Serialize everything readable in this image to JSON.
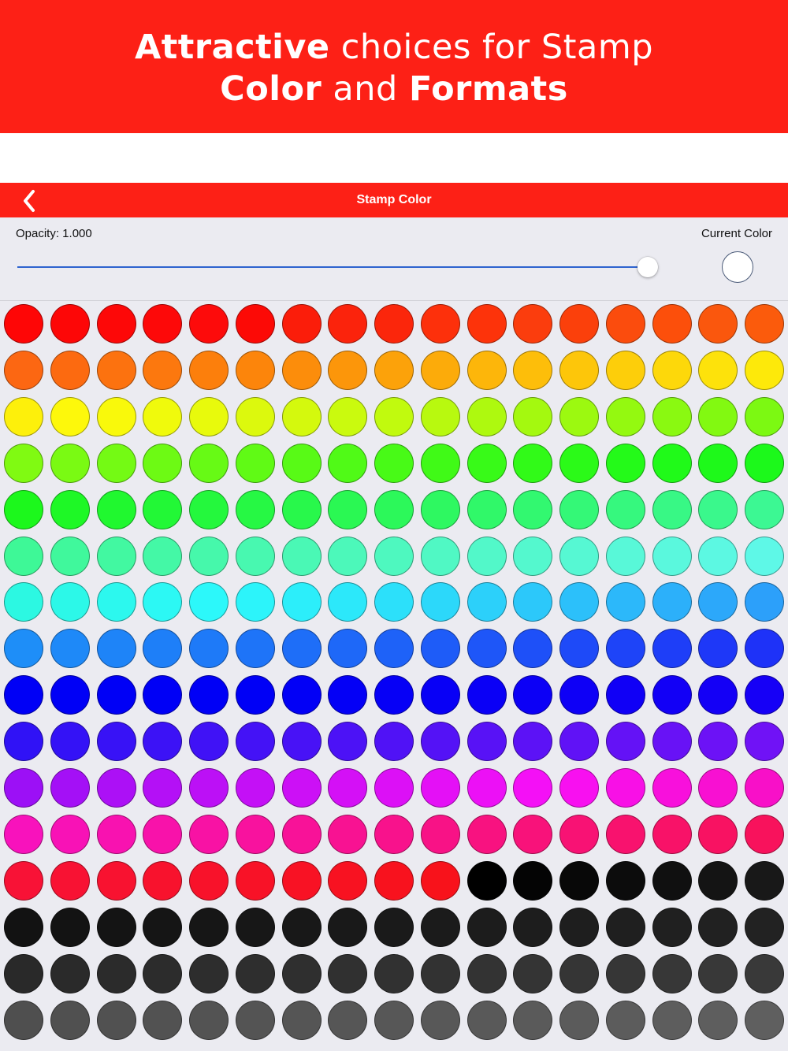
{
  "promo": {
    "line1_bold": "Attractive",
    "line1_rest": " choices for Stamp",
    "line2_bold1": "Color",
    "line2_mid": " and ",
    "line2_bold2": "Formats",
    "background": "#fd2016"
  },
  "navbar": {
    "title": "Stamp Color",
    "back_icon": "chevron-left-icon",
    "background": "#fd2016"
  },
  "controls": {
    "opacity_label": "Opacity: 1.000",
    "opacity_value": 1.0,
    "current_color_label": "Current Color",
    "current_color": "#ffffff",
    "slider_color": "#2e63cf"
  },
  "palette": {
    "rows": 16,
    "columns": 17,
    "colors": [
      "#fe0606",
      "#fd0707",
      "#fd0808",
      "#fd0909",
      "#fd0b0b",
      "#fc0a06",
      "#fb1d0a",
      "#fb230c",
      "#fb260b",
      "#fd300b",
      "#fd330a",
      "#fb3d0d",
      "#fb400b",
      "#fb4c0d",
      "#fc4f0b",
      "#fa570d",
      "#fb5b0c",
      "#fc6712",
      "#fc6a10",
      "#fc720f",
      "#fc780e",
      "#fc7f0c",
      "#fc850b",
      "#fc8d0b",
      "#fc960a",
      "#fca20a",
      "#fcab0a",
      "#fdb60a",
      "#fdbe0a",
      "#fdc60a",
      "#fdce0a",
      "#fdd80a",
      "#fde20b",
      "#fde90a",
      "#fdf00b",
      "#fdf80b",
      "#f9f90b",
      "#f0fa0c",
      "#e8fa0c",
      "#dcf90d",
      "#d4f90d",
      "#cafa0e",
      "#c1fa0e",
      "#b8f90f",
      "#aef90f",
      "#a4f90f",
      "#9cf910",
      "#94f910",
      "#8af911",
      "#82f911",
      "#7cf912",
      "#80fa12",
      "#7afa13",
      "#74fa14",
      "#6dfa14",
      "#67fa15",
      "#60fa15",
      "#58fa16",
      "#50fa17",
      "#48fa17",
      "#40fa17",
      "#38fa18",
      "#31fa18",
      "#2bfa18",
      "#24fa19",
      "#20fa19",
      "#1ef91a",
      "#1cf91b",
      "#1cf81c",
      "#1ef826",
      "#20f82f",
      "#22f836",
      "#24f83d",
      "#26f844",
      "#28f84b",
      "#2af853",
      "#2cf85a",
      "#2ef861",
      "#30f869",
      "#32f870",
      "#34f877",
      "#36f87e",
      "#38f885",
      "#3af88c",
      "#3cf893",
      "#3ef897",
      "#40f89c",
      "#42f8a1",
      "#44f8a6",
      "#46f8ab",
      "#48f8b0",
      "#4af8b5",
      "#4cf8ba",
      "#4ef8bf",
      "#50f8c4",
      "#52f8c9",
      "#54f8ce",
      "#56f8d3",
      "#58f8d8",
      "#5af8dd",
      "#5cf8e2",
      "#5ef8e7",
      "#2cf8e2",
      "#2cf8e8",
      "#2cf8ee",
      "#2cf8f4",
      "#2cf8fa",
      "#2cf4fa",
      "#2ceefa",
      "#2ce8fa",
      "#2ce0fa",
      "#2cd8fa",
      "#2cd0fa",
      "#2cc8fa",
      "#2cc0fa",
      "#2cb8fa",
      "#2cb0fa",
      "#2ca8fa",
      "#2ca0fa",
      "#1e8ef8",
      "#1e89f8",
      "#1e84f8",
      "#1e7ff8",
      "#1e7af8",
      "#1e74f8",
      "#1e6ef8",
      "#1e68f8",
      "#1e62f8",
      "#1e5cf8",
      "#1e56f8",
      "#1e50f8",
      "#1e4af8",
      "#1e44f8",
      "#1e3ef8",
      "#1e38f8",
      "#1e32f8",
      "#0000f6",
      "#0000f6",
      "#0000f6",
      "#0000f6",
      "#0000f6",
      "#0000f6",
      "#0200f6",
      "#0400f6",
      "#0600f6",
      "#0800f6",
      "#0a00f6",
      "#0c00f6",
      "#0e00f6",
      "#1000f6",
      "#1200f6",
      "#1400f6",
      "#1600f6",
      "#3012f6",
      "#3412f6",
      "#3812f6",
      "#3c12f6",
      "#4012f6",
      "#4412f6",
      "#4812f6",
      "#4c12f6",
      "#5012f6",
      "#5412f6",
      "#5812f6",
      "#5c12f6",
      "#6012f6",
      "#6412f6",
      "#6812f6",
      "#6c12f6",
      "#7012f6",
      "#9c10f6",
      "#a410f6",
      "#ac10f6",
      "#b410f6",
      "#bc10f6",
      "#c410f6",
      "#cc10f6",
      "#d410f6",
      "#dc10f6",
      "#e410f6",
      "#ec10f6",
      "#f410f6",
      "#f810f0",
      "#f810e6",
      "#f810dc",
      "#f810d2",
      "#f810c8",
      "#f812bc",
      "#f812b6",
      "#f812b0",
      "#f812aa",
      "#f812a4",
      "#f8129e",
      "#f81298",
      "#f81292",
      "#f8128c",
      "#f81286",
      "#f81280",
      "#f8127a",
      "#f81274",
      "#f8126e",
      "#f81268",
      "#f81262",
      "#f8125c",
      "#f81236",
      "#f81233",
      "#f81230",
      "#f8122d",
      "#f8122a",
      "#f81227",
      "#f81224",
      "#f81221",
      "#f8121e",
      "#f8121b",
      "#000000",
      "#040404",
      "#080808",
      "#0c0c0c",
      "#101010",
      "#141414",
      "#181818",
      "#121212",
      "#131313",
      "#141414",
      "#151515",
      "#161616",
      "#171717",
      "#181818",
      "#191919",
      "#1a1a1a",
      "#1b1b1b",
      "#1c1c1c",
      "#1d1d1d",
      "#1e1e1e",
      "#1f1f1f",
      "#202020",
      "#212121",
      "#222222",
      "#292929",
      "#2a2a2a",
      "#2b2b2b",
      "#2c2c2c",
      "#2d2d2d",
      "#2e2e2e",
      "#2f2f2f",
      "#303030",
      "#313131",
      "#323232",
      "#333333",
      "#343434",
      "#353535",
      "#363636",
      "#373737",
      "#383838",
      "#393939",
      "#4f4f4f",
      "#505050",
      "#515151",
      "#525252",
      "#535353",
      "#545454",
      "#555555",
      "#565656",
      "#575757",
      "#585858",
      "#595959",
      "#5a5a5a",
      "#5b5b5b",
      "#5c5c5c",
      "#5d5d5d",
      "#5e5e5e",
      "#5f5f5f"
    ]
  }
}
